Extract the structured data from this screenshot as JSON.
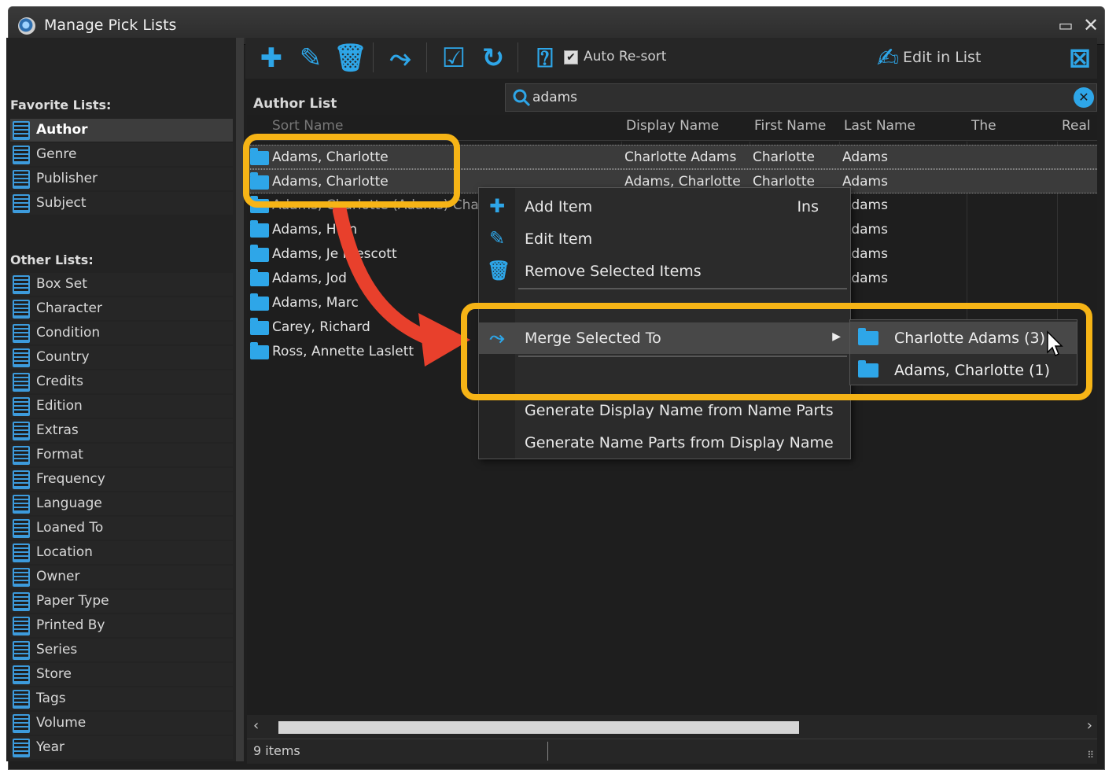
{
  "window": {
    "title": "Manage Pick Lists"
  },
  "sidebar": {
    "favorite_title": "Favorite Lists:",
    "favorites": [
      "Author",
      "Genre",
      "Publisher",
      "Subject"
    ],
    "other_title": "Other Lists:",
    "others": [
      "Box Set",
      "Character",
      "Condition",
      "Country",
      "Credits",
      "Edition",
      "Extras",
      "Format",
      "Frequency",
      "Language",
      "Loaned To",
      "Location",
      "Owner",
      "Paper Type",
      "Printed By",
      "Series",
      "Store",
      "Tags",
      "Volume",
      "Year"
    ]
  },
  "toolbar": {
    "auto_resort_label": "Auto Re-sort",
    "auto_resort_checked": true,
    "edit_in_list_label": "Edit in List"
  },
  "list": {
    "title": "Author List",
    "search_value": "adams",
    "columns": [
      "Sort Name",
      "Display Name",
      "First Name",
      "Last Name",
      "The",
      "Real"
    ],
    "rows": [
      {
        "sort": "Adams, Charlotte",
        "display": "Charlotte Adams",
        "first": "Charlotte",
        "last": "Adams"
      },
      {
        "sort": "Adams, Charlotte",
        "display": "Adams, Charlotte",
        "first": "Charlotte",
        "last": "Adams"
      },
      {
        "sort": "Adams, Charlotte (Adams) Cha",
        "display": "",
        "first": "",
        "last": "Adams"
      },
      {
        "sort": "Adams, H en",
        "display": "",
        "first": "",
        "last": "Adams"
      },
      {
        "sort": "Adams, Je Prescott",
        "display": "",
        "first": "",
        "last": "Adams"
      },
      {
        "sort": "Adams, Jod",
        "display": "",
        "first": "",
        "last": "Adams"
      },
      {
        "sort": "Adams, Marc",
        "display": "",
        "first": "",
        "last": "Adams"
      },
      {
        "sort": "Carey, Richard",
        "display": "",
        "first": "",
        "last": ""
      },
      {
        "sort": "Ross, Annette Laslett",
        "display": "",
        "first": "",
        "last": ""
      }
    ]
  },
  "context_menu": {
    "add_item": "Add Item",
    "add_item_shortcut": "Ins",
    "edit_item": "Edit Item",
    "remove_items": "Remove Selected Items",
    "merge_to": "Merge Selected To",
    "gen_display": "Generate Display Name from Name Parts",
    "gen_parts": "Generate Name Parts from Display Name"
  },
  "submenu": [
    "Charlotte Adams (3)",
    "Adams, Charlotte (1)"
  ],
  "status": {
    "count": "9 items"
  },
  "colors": {
    "accent": "#2ea6e8",
    "highlight": "#f6b416",
    "arrow": "#e8402c"
  }
}
